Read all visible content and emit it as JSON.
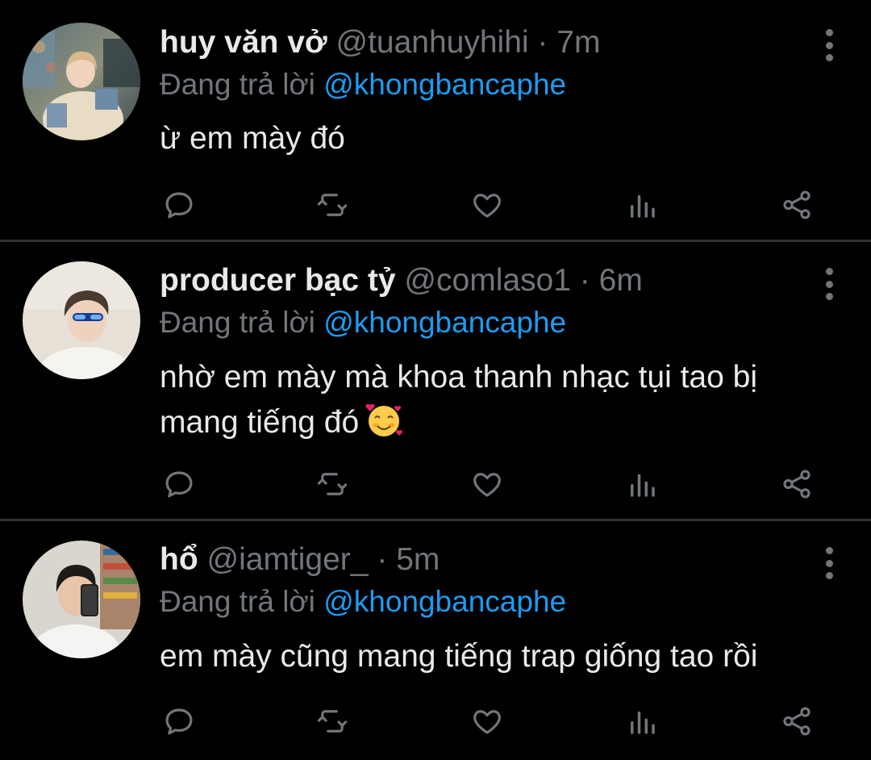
{
  "tweets": [
    {
      "display_name": "huy văn vở",
      "handle": "@tuanhuyhihi",
      "separator": "·",
      "time": "7m",
      "reply_prefix": "Đang trả lời",
      "reply_to": "@khongbancaphe",
      "text": "ừ em mày đó",
      "avatar_icon": "avatar-photo"
    },
    {
      "display_name": "producer bạc tỷ",
      "handle": "@comlaso1",
      "separator": "·",
      "time": "6m",
      "reply_prefix": "Đang trả lời",
      "reply_to": "@khongbancaphe",
      "text": "nhờ em mày mà khoa thanh nhạc tụi tao bị mang tiếng đó",
      "text_emoji": "smiling-face-with-hearts",
      "avatar_icon": "avatar-photo"
    },
    {
      "display_name": "hổ",
      "handle": "@iamtiger_",
      "separator": "·",
      "time": "5m",
      "reply_prefix": "Đang trả lời",
      "reply_to": "@khongbancaphe",
      "text": "em mày cũng mang tiếng trap giống tao rồi",
      "avatar_icon": "avatar-photo"
    }
  ],
  "action_icons": [
    "reply-icon",
    "retweet-icon",
    "like-icon",
    "views-icon",
    "share-icon"
  ],
  "colors": {
    "background": "#000000",
    "text_primary": "#e7e9ea",
    "text_secondary": "#71767b",
    "accent": "#1d9bf0",
    "divider": "#2f3336"
  }
}
